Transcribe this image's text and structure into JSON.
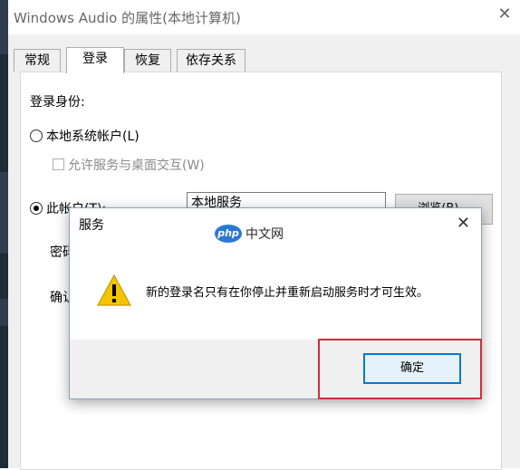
{
  "window": {
    "title": "Windows Audio 的属性(本地计算机)",
    "close_icon": "✕",
    "tabs": [
      {
        "label": "常规"
      },
      {
        "label": "登录",
        "active": true
      },
      {
        "label": "恢复"
      },
      {
        "label": "依存关系"
      }
    ]
  },
  "login": {
    "section_label": "登录身份:",
    "local_system_label": "本地系统帐户(L)",
    "allow_desktop_label": "允许服务与桌面交互(W)",
    "this_account_label": "此帐户(T):",
    "this_account_value": "本地服务",
    "browse_label": "浏览(B)...",
    "password_label": "密码",
    "confirm_label": "确认",
    "selected_radio": "this_account"
  },
  "dialog": {
    "title": "服务",
    "close_icon": "✕",
    "watermark_logo": "php",
    "watermark_text": "中文网",
    "message": "新的登录名只有在你停止并重新启动服务时才可生效。",
    "icon": "warning-icon",
    "ok_label": "确定"
  },
  "colors": {
    "highlight_border": "#c9313a",
    "button_focus": "#0078d7",
    "warning_yellow": "#f4c400"
  }
}
